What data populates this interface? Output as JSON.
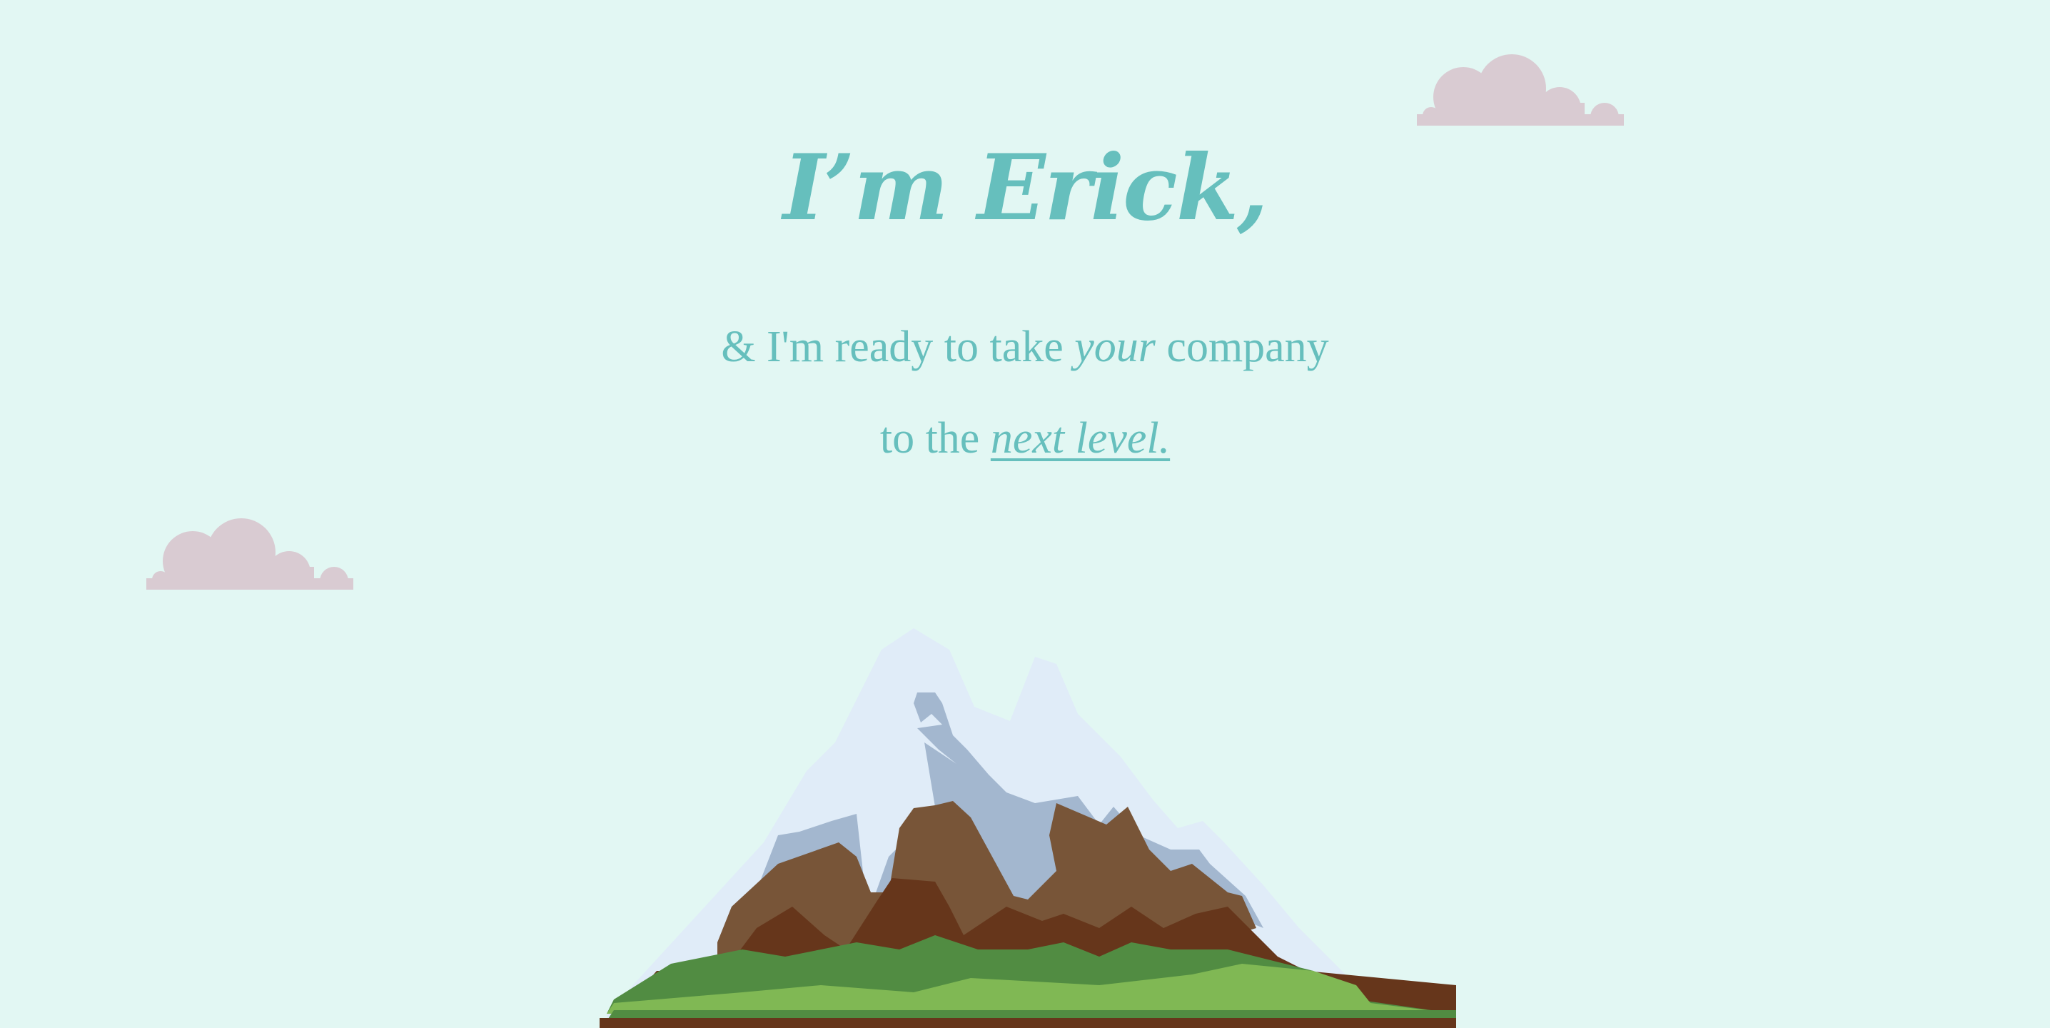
{
  "hero": {
    "title": "I’m Erick,",
    "line1_pre": "& I'm ready to take ",
    "line1_em": "your",
    "line1_post": " company",
    "line2_pre": "to the ",
    "line2_link": "next level."
  },
  "colors": {
    "background": "#e2f7f3",
    "accent": "#66bfbd",
    "cloud": "#d9cbd2",
    "snow": "#e0ecf8",
    "rock_shadow": "#a3b7cf",
    "rock_light": "#785538",
    "rock_dark": "#66361b",
    "grass_dark": "#518c42",
    "grass_light": "#80b854"
  },
  "illustrations": {
    "cloud_icon": "cloud-icon",
    "mountain_icon": "mountain-icon"
  }
}
